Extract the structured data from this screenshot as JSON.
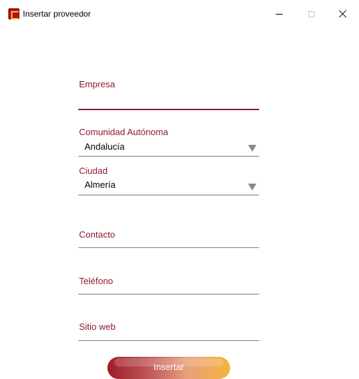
{
  "window": {
    "title": "Insertar proveedor",
    "accent_color": "#8e1b2c"
  },
  "form": {
    "empresa": {
      "label": "Empresa",
      "value": ""
    },
    "comunidad": {
      "label": "Comunidad Autónoma",
      "selected": "Andalucía"
    },
    "ciudad": {
      "label": "Ciudad",
      "selected": "Almería"
    },
    "contacto": {
      "label": "Contacto",
      "value": ""
    },
    "telefono": {
      "label": "Teléfono",
      "value": ""
    },
    "sitio_web": {
      "label": "Sitio web",
      "value": ""
    },
    "submit_label": "Insertar"
  },
  "icons": {
    "app": "app-logo-icon",
    "minimize": "minimize-icon",
    "maximize": "maximize-icon",
    "close": "close-icon",
    "dropdown": "triangle-down-icon"
  }
}
